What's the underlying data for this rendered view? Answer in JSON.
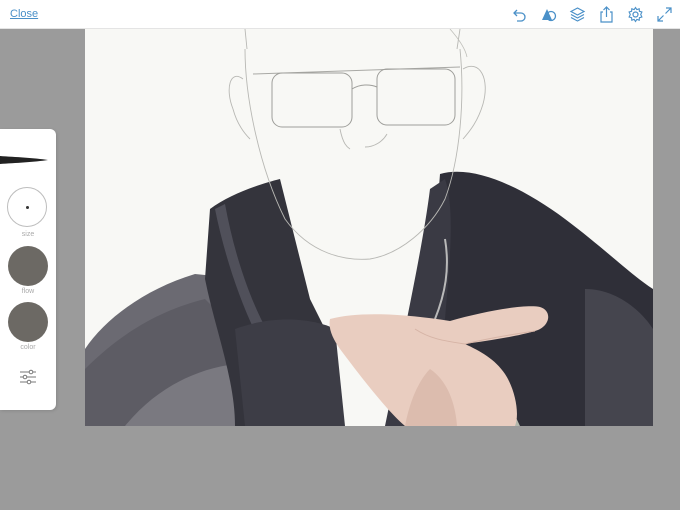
{
  "topbar": {
    "close_label": "Close",
    "icons": [
      "undo-icon",
      "shapes-icon",
      "layers-icon",
      "share-icon",
      "settings-icon",
      "fullscreen-icon"
    ]
  },
  "toolpanel": {
    "size_label": "size",
    "flow_label": "flow",
    "color_label": "color"
  },
  "colors": {
    "accent": "#4a90c8",
    "panel_bg": "#ffffff",
    "workspace_bg": "#9b9b9b",
    "canvas_bg": "#f8f8f5",
    "brush_swatch": "#6c6964",
    "hoodie_dark": "#2f2f38",
    "hoodie_gray": "#6b6a72",
    "skin": "#e9cdc0"
  }
}
